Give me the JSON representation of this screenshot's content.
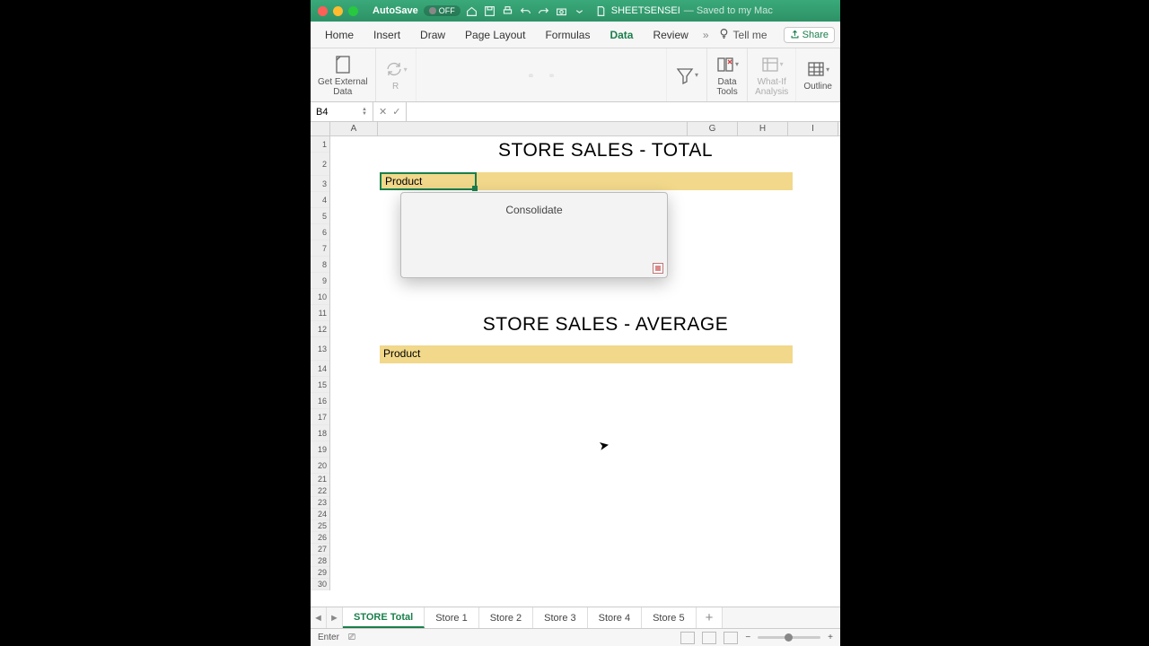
{
  "titlebar": {
    "autosave_label": "AutoSave",
    "autosave_state": "OFF",
    "doc_name": "SHEETSENSEI",
    "doc_status": "— Saved to my Mac"
  },
  "tabs": {
    "home": "Home",
    "insert": "Insert",
    "draw": "Draw",
    "page_layout": "Page Layout",
    "formulas": "Formulas",
    "data": "Data",
    "review": "Review",
    "tell_me": "Tell me",
    "share": "Share"
  },
  "ribbon": {
    "get_external_data": "Get External\nData",
    "refresh_prefix": "R",
    "sort_filter": "",
    "data_tools": "Data\nTools",
    "whatif": "What-If\nAnalysis",
    "outline": "Outline"
  },
  "popup": {
    "title": "Consolidate"
  },
  "formula_bar": {
    "cell_ref": "B4"
  },
  "columns": [
    "A",
    "G",
    "H",
    "I"
  ],
  "rows_first": [
    "1",
    "2",
    "3",
    "4",
    "5",
    "6",
    "7",
    "8",
    "9",
    "10",
    "11",
    "12",
    "13",
    "14",
    "15",
    "16",
    "17",
    "18",
    "19",
    "20"
  ],
  "rows_second": [
    "21",
    "22",
    "23",
    "24",
    "25",
    "26",
    "27",
    "28",
    "29",
    "30"
  ],
  "content": {
    "title_total": "STORE SALES - TOTAL",
    "title_avg": "STORE SALES - AVERAGE",
    "product_label": "Product"
  },
  "sheet_tabs": [
    "STORE Total",
    "Store 1",
    "Store 2",
    "Store 3",
    "Store 4",
    "Store 5"
  ],
  "status": {
    "mode": "Enter"
  }
}
